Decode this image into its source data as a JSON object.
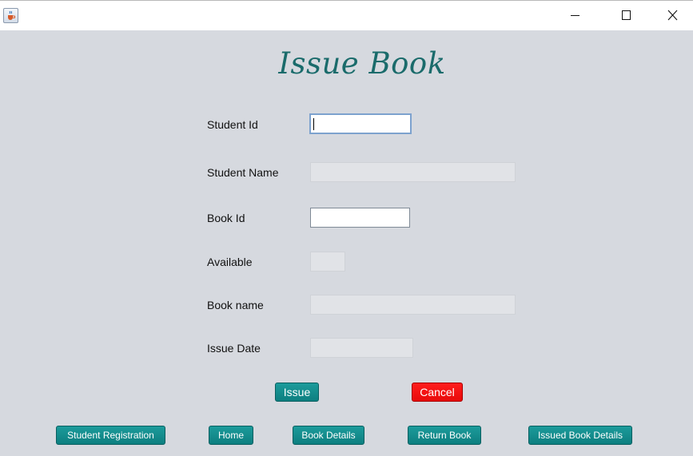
{
  "window": {
    "app_icon": "java-coffee-cup-icon",
    "controls": [
      "minimize-icon",
      "maximize-icon",
      "close-icon"
    ]
  },
  "heading": "Issue Book",
  "form": {
    "student_id": {
      "label": "Student Id",
      "value": ""
    },
    "student_name": {
      "label": "Student Name",
      "value": ""
    },
    "book_id": {
      "label": "Book Id",
      "value": ""
    },
    "available": {
      "label": "Available",
      "value": ""
    },
    "book_name": {
      "label": "Book name",
      "value": ""
    },
    "issue_date": {
      "label": "Issue Date",
      "value": ""
    }
  },
  "actions": {
    "issue": "Issue",
    "cancel": "Cancel"
  },
  "nav": {
    "student_registration": "Student Registration",
    "home": "Home",
    "book_details": "Book Details",
    "return_book": "Return Book",
    "issued_book_details": "Issued Book Details"
  },
  "colors": {
    "background": "#d6d9df",
    "heading": "#1a6b6b",
    "teal_button": "#0d8a8b",
    "cancel_button": "#f21212"
  }
}
